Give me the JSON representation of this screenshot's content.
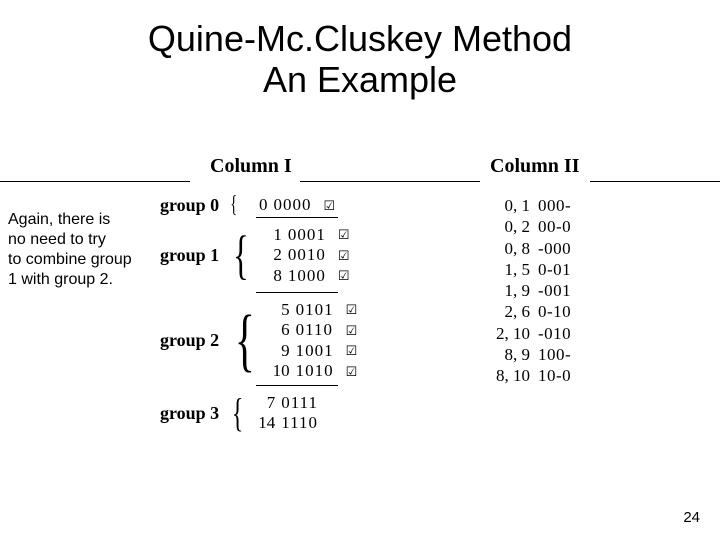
{
  "title_line1": "Quine-Mc.Cluskey Method",
  "title_line2": "An Example",
  "side_note_l1": "Again, there is",
  "side_note_l2": "no need to try",
  "side_note_l3": "to combine group",
  "side_note_l4": "1 with group 2.",
  "col1_heading": "Column I",
  "col2_heading": "Column II",
  "tick": "☑",
  "groups": {
    "g0": {
      "label": "group 0",
      "brace_size": "24px",
      "rows": [
        {
          "m": "0",
          "b": "0000",
          "t": true
        }
      ]
    },
    "g1": {
      "label": "group 1",
      "brace_size": "54px",
      "rows": [
        {
          "m": "1",
          "b": "0001",
          "t": true
        },
        {
          "m": "2",
          "b": "0010",
          "t": true
        },
        {
          "m": "8",
          "b": "1000",
          "t": true
        }
      ]
    },
    "g2": {
      "label": "group 2",
      "brace_size": "70px",
      "rows": [
        {
          "m": "5",
          "b": "0101",
          "t": true
        },
        {
          "m": "6",
          "b": "0110",
          "t": true
        },
        {
          "m": "9",
          "b": "1001",
          "t": true
        },
        {
          "m": "10",
          "b": "1010",
          "t": true
        }
      ]
    },
    "g3": {
      "label": "group 3",
      "brace_size": "40px",
      "rows": [
        {
          "m": "7",
          "b": "0111",
          "t": false
        },
        {
          "m": "14",
          "b": "1110",
          "t": false
        }
      ]
    }
  },
  "col2_rows": [
    {
      "pair": "0, 1",
      "pat": "000-"
    },
    {
      "pair": "0, 2",
      "pat": "00-0"
    },
    {
      "pair": "0, 8",
      "pat": "-000"
    },
    {
      "pair": "1, 5",
      "pat": "0-01"
    },
    {
      "pair": "1, 9",
      "pat": "-001"
    },
    {
      "pair": "2, 6",
      "pat": "0-10"
    },
    {
      "pair": "2, 10",
      "pat": "-010"
    },
    {
      "pair": "8, 9",
      "pat": "100-"
    },
    {
      "pair": "8, 10",
      "pat": "10-0"
    }
  ],
  "page_number": "24"
}
